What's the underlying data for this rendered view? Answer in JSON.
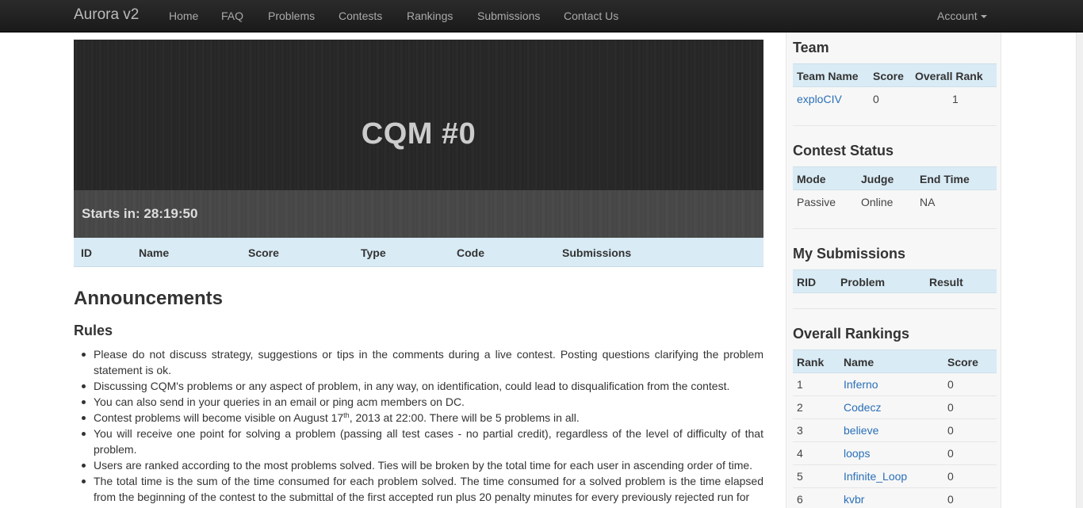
{
  "brand": "Aurora v2",
  "nav": {
    "items": [
      "Home",
      "FAQ",
      "Problems",
      "Contests",
      "Rankings",
      "Submissions",
      "Contact Us"
    ],
    "account": "Account"
  },
  "contest": {
    "title": "CQM #0",
    "countdown": "Starts in: 28:19:50"
  },
  "problems_table": {
    "columns": [
      "ID",
      "Name",
      "Score",
      "Type",
      "Code",
      "Submissions"
    ]
  },
  "announcements": {
    "heading": "Announcements",
    "rules_heading": "Rules",
    "rules": [
      "Please do not discuss strategy, suggestions or tips in the comments during a live contest. Posting questions clarifying the problem statement is ok.",
      "Discussing CQM's problems or any aspect of problem, in any way, on identification, could lead to disqualification from the contest.",
      "You can also send in your queries in an email or ping acm members on DC.",
      {
        "before": "Contest problems will become visible on August 17",
        "sup": "th",
        "after": ", 2013 at 22:00. There will be 5 problems in all."
      },
      "You will receive one point for solving a problem (passing all test cases - no partial credit), regardless of the level of difficulty of that problem.",
      "Users are ranked according to the most problems solved. Ties will be broken by the total time for each user in ascending order of time.",
      "The total time is the sum of the time consumed for each problem solved. The time consumed for a solved problem is the time elapsed from the beginning of the contest to the submittal of the first accepted run plus 20 penalty minutes for every previously rejected run for"
    ]
  },
  "sidebar": {
    "team": {
      "title": "Team",
      "columns": [
        "Team Name",
        "Score",
        "Overall Rank"
      ],
      "row": {
        "name": "exploCIV",
        "score": "0",
        "rank": "1"
      }
    },
    "status": {
      "title": "Contest Status",
      "columns": [
        "Mode",
        "Judge",
        "End Time"
      ],
      "row": {
        "mode": "Passive",
        "judge": "Online",
        "end": "NA"
      }
    },
    "submissions": {
      "title": "My Submissions",
      "columns": [
        "RID",
        "Problem",
        "Result"
      ]
    },
    "rankings": {
      "title": "Overall Rankings",
      "columns": [
        "Rank",
        "Name",
        "Score"
      ],
      "rows": [
        {
          "rank": "1",
          "name": "Inferno",
          "score": "0"
        },
        {
          "rank": "2",
          "name": "Codecz",
          "score": "0"
        },
        {
          "rank": "3",
          "name": "believe",
          "score": "0"
        },
        {
          "rank": "4",
          "name": "loops",
          "score": "0"
        },
        {
          "rank": "5",
          "name": "Infinite_Loop",
          "score": "0"
        },
        {
          "rank": "6",
          "name": "kvbr",
          "score": "0"
        }
      ]
    }
  }
}
